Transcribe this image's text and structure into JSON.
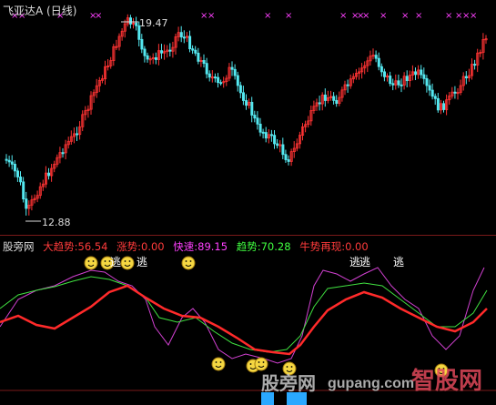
{
  "price_panel": {
    "stock_name": "飞亚达A",
    "period": "(日线)",
    "high_label": "19.47",
    "low_label": "12.88"
  },
  "indicator_panel": {
    "name": "股旁网",
    "values": [
      {
        "label": "大趋势:",
        "value": "56.54",
        "color": "#ff3b3b"
      },
      {
        "label": "涨势:",
        "value": "0.00",
        "color": "#ff3b3b"
      },
      {
        "label": "快速:",
        "value": "89.15",
        "color": "#ff40ff"
      },
      {
        "label": "趋势:",
        "value": "70.28",
        "color": "#40ff40"
      },
      {
        "label": "牛势再现:",
        "value": "0.00",
        "color": "#ff3b3b"
      }
    ],
    "escape_labels": [
      "逃",
      "逃",
      "逃",
      "逃"
    ]
  },
  "colors": {
    "up_candle": "#ff3333",
    "down_candle": "#54e8f0",
    "marker": "#ff40ff",
    "smiley": "#f5d742",
    "block": "#2aa8ff"
  },
  "watermark": {
    "site_cn": "股旁网",
    "url": "gupang.com",
    "logo": "智股网"
  }
}
